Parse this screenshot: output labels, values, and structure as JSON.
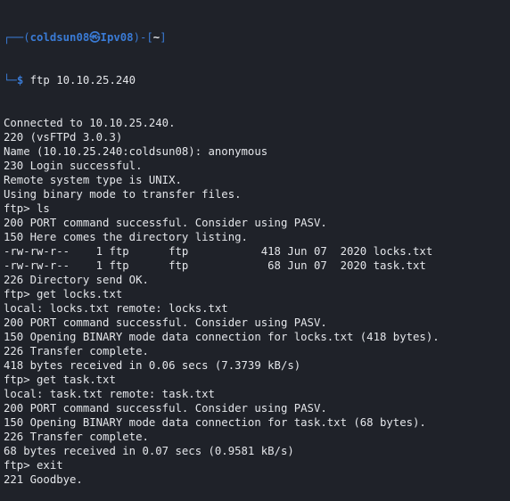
{
  "prompt": {
    "frame_top": "┌──(",
    "user_host": "coldsun08㉿Ipv08",
    "frame_mid": ")-[",
    "cwd": "~",
    "frame_end": "]",
    "frame_bottom": "└─",
    "dollar": "$",
    "command": "ftp 10.10.25.240"
  },
  "output_lines": [
    "Connected to 10.10.25.240.",
    "220 (vsFTPd 3.0.3)",
    "Name (10.10.25.240:coldsun08): anonymous",
    "230 Login successful.",
    "Remote system type is UNIX.",
    "Using binary mode to transfer files.",
    "ftp> ls",
    "200 PORT command successful. Consider using PASV.",
    "150 Here comes the directory listing.",
    "-rw-rw-r--    1 ftp      ftp           418 Jun 07  2020 locks.txt",
    "-rw-rw-r--    1 ftp      ftp            68 Jun 07  2020 task.txt",
    "226 Directory send OK.",
    "ftp> get locks.txt",
    "local: locks.txt remote: locks.txt",
    "200 PORT command successful. Consider using PASV.",
    "150 Opening BINARY mode data connection for locks.txt (418 bytes).",
    "226 Transfer complete.",
    "418 bytes received in 0.06 secs (7.3739 kB/s)",
    "ftp> get task.txt",
    "local: task.txt remote: task.txt",
    "200 PORT command successful. Consider using PASV.",
    "150 Opening BINARY mode data connection for task.txt (68 bytes).",
    "226 Transfer complete.",
    "68 bytes received in 0.07 secs (0.9581 kB/s)",
    "ftp> exit",
    "221 Goodbye."
  ],
  "colors": {
    "background": "#1f2229",
    "text": "#e4e6ea",
    "prompt_accent": "#3a7bd5"
  }
}
